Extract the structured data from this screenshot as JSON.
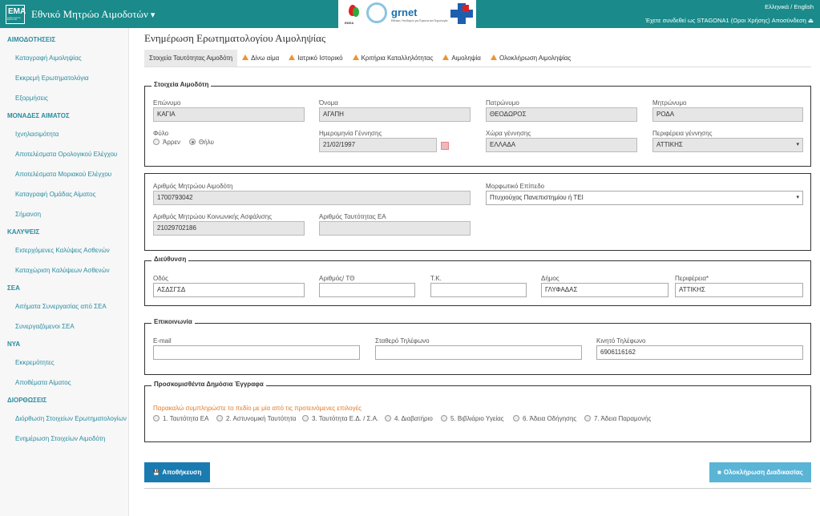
{
  "header": {
    "logo_text": "ΕΜΑ",
    "logo_sub": "ΕΘΝΙΚΟ ΜΗΤΡΩΟ ΑΙΜΟΔΟΤΩΝ",
    "app_title": "Εθνικό Μητρώο Αιμοδοτών",
    "menu_caret": "▾",
    "ekea_label": "ΕΚΕΑ",
    "grnet_label": "grnet",
    "grnet_sub": "Εθνικές Υποδομές για Έρευνα και Τεχνολογία",
    "language_links": "Ελληνικά / English",
    "login_info": "Έχετε συνδεθεί ως STAGONA1 (Οροι Χρήσης) Αποσύνδεση"
  },
  "sidebar": {
    "sections": [
      {
        "title": "ΑΙΜΟΔΟΤΗΣΕΙΣ",
        "items": [
          "Καταγραφή Αιμοληψίας",
          "Εκκρεμή Ερωτηματολόγια",
          "Εξορμήσεις"
        ]
      },
      {
        "title": "ΜΟΝΑΔΕΣ ΑΙΜΑΤΟΣ",
        "items": [
          "Ιχνηλασιμότητα",
          "Αποτελέσματα Ορολογικού Ελέγχου",
          "Αποτελέσματα Μοριακού Ελέγχου",
          "Καταγραφή Ομάδας Αίματος",
          "Σήμανση"
        ]
      },
      {
        "title": "ΚΑΛΥΨΕΙΣ",
        "items": [
          "Εισερχόμενες Καλύψεις Ασθενών",
          "Καταχώριση Καλύψεων Ασθενών"
        ]
      },
      {
        "title": "ΣΕΑ",
        "items": [
          "Αιτήματα Συνεργασίας από ΣΕΑ",
          "Συνεργαζόμενοι ΣΕΑ"
        ]
      },
      {
        "title": "ΝΥΑ",
        "items": [
          "Εκκρεμότητες",
          "Αποθέματα Αίματος"
        ]
      },
      {
        "title": "ΔΙΟΡΘΩΣΕΙΣ",
        "items": [
          "Διόρθωση Στοιχείων Ερωτηματολογίων",
          "Ενημέρωση Στοιχείων Αιμοδότη"
        ]
      }
    ]
  },
  "main": {
    "title": "Ενημέρωση Ερωτηματολογίου Αιμοληψίας",
    "tabs": [
      {
        "label": "Στοιχεία Ταυτότητας Αιμοδότη",
        "warn": false
      },
      {
        "label": "Δίνω αίμα",
        "warn": true
      },
      {
        "label": "Ιατρικό Ιστορικό",
        "warn": true
      },
      {
        "label": "Κριτήρια Καταλληλότητας",
        "warn": true
      },
      {
        "label": "Αιμοληψία",
        "warn": true
      },
      {
        "label": "Ολοκλήρωση Αιμοληψίας",
        "warn": true
      }
    ],
    "donor": {
      "legend": "Στοιχεία Αιμοδότη",
      "surname_label": "Επώνυμο",
      "surname": "ΚΑΓΙΑ",
      "name_label": "Όνομα",
      "name": "ΑΓΑΠΗ",
      "father_label": "Πατρώνυμο",
      "father": "ΘΕΟΔΩΡΟΣ",
      "mother_label": "Μητρώνυμο",
      "mother": "ΡΟΔΑ",
      "sex_label": "Φύλο",
      "male": "Άρρεν",
      "female": "Θήλυ",
      "birthdate_label": "Ημερομηνία Γέννησης",
      "birthdate": "21/02/1997",
      "birth_country_label": "Χώρα γέννησης",
      "birth_country": "ΕΛΛΑΔΑ",
      "birth_region_label": "Περιφέρεια γέννησης",
      "birth_region": "ΑΤΤΙΚΗΣ"
    },
    "registry": {
      "registry_no_label": "Αριθμός Μητρώου Αιμοδότη",
      "registry_no": "1700793042",
      "education_label": "Μορφωτικό Επίπεδο",
      "education": "Πτυχιούχος Πανεπιστημίου ή ΤΕΙ",
      "amka_label": "Αριθμός Μητρώου Κοινωνικής Ασφάλισης",
      "amka": "21029702186",
      "id_label": "Αριθμός Ταυτότητας ΕΑ",
      "id": ""
    },
    "address": {
      "legend": "Διεύθυνση",
      "street_label": "Οδός",
      "street": "ΑΣΔΣΓΣΔ",
      "number_label": "Αριθμός/ ΤΘ",
      "number": "",
      "zip_label": "Τ.Κ.",
      "zip": "",
      "municipality_label": "Δήμος",
      "municipality": "ΓΛΥΦΑΔΑΣ",
      "region_label": "Περιφέρεια*",
      "region": "ΑΤΤΙΚΗΣ"
    },
    "contact": {
      "legend": "Επικοινωνία",
      "email_label": "E-mail",
      "email": "",
      "phone_label": "Σταθερό Τηλέφωνο",
      "phone": "",
      "mobile_label": "Κινητό Τηλέφωνο",
      "mobile": "6906116162"
    },
    "documents": {
      "legend": "Προσκομισθέντα Δημόσια Έγγραφα",
      "hint": "Παρακαλώ συμπληρώστε το πεδίο με μία από τις προτεινόμενες επιλογές",
      "options": [
        "1. Ταυτότητα ΕΑ",
        "2. Αστυνομική Ταυτότητα",
        "3. Ταυτότητα Ε.Δ. / Σ.Α.",
        "4. Διαβατήριο",
        "5. Βιβλιάριο Υγείας",
        "6. Άδεια Οδήγησης",
        "7. Άδεια Παραμονής"
      ]
    },
    "buttons": {
      "save": "Αποθήκευση",
      "complete": "Ολοκλήρωση Διαδικασίας",
      "save_icon": "💾",
      "complete_icon": "■"
    }
  },
  "colors": {
    "header_bg": "#1a8a8a",
    "sidebar_link": "#2a8ca0",
    "save_btn": "#1a7bb0",
    "complete_btn": "#5ab4d6",
    "warning": "#f0932b"
  }
}
